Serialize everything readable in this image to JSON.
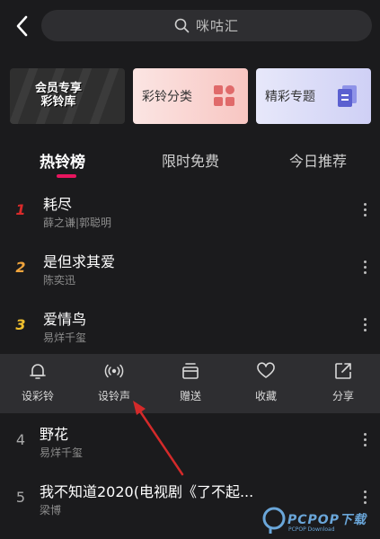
{
  "search": {
    "placeholder": "咪咕汇"
  },
  "cards": [
    {
      "label": "会员专享\n彩铃库"
    },
    {
      "label": "彩铃分类"
    },
    {
      "label": "精彩专题"
    }
  ],
  "tabs": [
    {
      "label": "热铃榜",
      "active": true
    },
    {
      "label": "限时免费"
    },
    {
      "label": "今日推荐"
    }
  ],
  "songs_top": [
    {
      "rank": "1",
      "title": "耗尽",
      "artist": "薛之谦|郭聪明",
      "rank_color": "#d92a2a"
    },
    {
      "rank": "2",
      "title": "是但求其爱",
      "artist": "陈奕迅",
      "rank_color": "#f0a43c"
    },
    {
      "rank": "3",
      "title": "爱情鸟",
      "artist": "易烊千玺",
      "rank_color": "#f2c12e"
    }
  ],
  "actions": [
    {
      "label": "设彩铃",
      "icon": "bell-icon"
    },
    {
      "label": "设铃声",
      "icon": "ringtone-icon"
    },
    {
      "label": "赠送",
      "icon": "gift-icon"
    },
    {
      "label": "收藏",
      "icon": "heart-icon"
    },
    {
      "label": "分享",
      "icon": "share-icon"
    }
  ],
  "songs_bottom": [
    {
      "rank": "4",
      "title": "野花",
      "artist": "易烊千玺"
    },
    {
      "rank": "5",
      "title": "我不知道2020(电视剧《了不起...",
      "artist": "梁博"
    }
  ],
  "watermark": {
    "text": "PCPOP下载",
    "sub": "PCPOP Download"
  },
  "colors": {
    "accent": "#e8155e",
    "annotation_arrow": "#d42a2a"
  }
}
